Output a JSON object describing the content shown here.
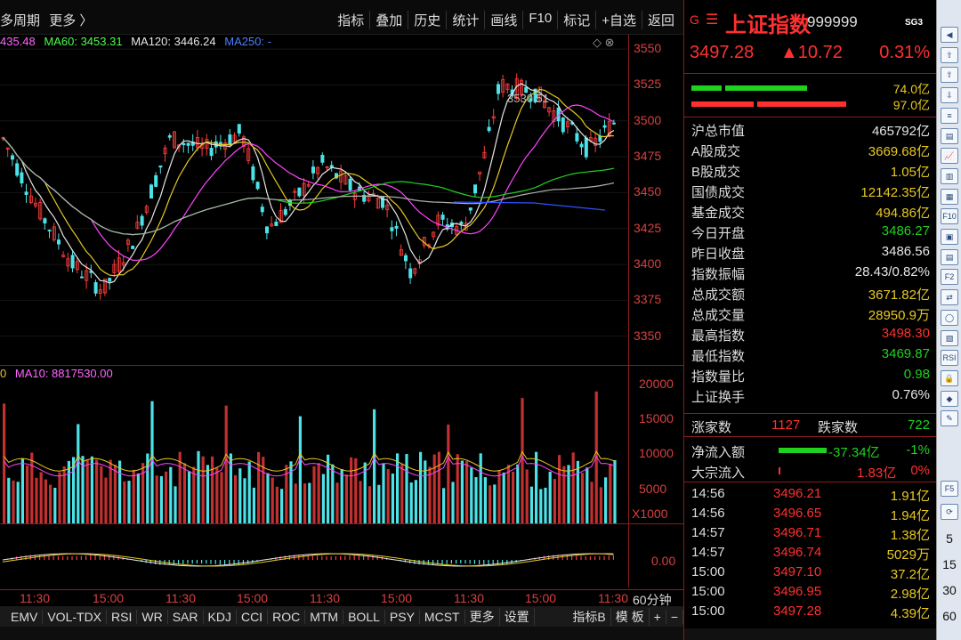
{
  "toolbar": {
    "period_label": "多周期",
    "more_label": "更多 〉",
    "items": [
      "指标",
      "叠加",
      "历史",
      "统计",
      "画线",
      "F10",
      "标记",
      "+自选",
      "返回"
    ]
  },
  "legend": {
    "ma_first": "435.48",
    "ma60": "MA60: 3453.31",
    "ma120": "MA120: 3446.24",
    "ma250": "MA250: -"
  },
  "volume_legend": {
    "prefix": "0",
    "ma10": "MA10: 8817530.00"
  },
  "price_axis": [
    "3550",
    "3525",
    "3500",
    "3475",
    "3450",
    "3425",
    "3400",
    "3375",
    "3350"
  ],
  "volume_axis": [
    "20000",
    "15000",
    "10000",
    "5000"
  ],
  "volume_unit": "X1000",
  "macd_axis": "0.00",
  "peak_label": "3530.51",
  "time_axis": [
    "11:30",
    "15:00",
    "11:30",
    "15:00",
    "11:30",
    "15:00",
    "11:30",
    "15:00",
    "11:30"
  ],
  "period": "60分钟",
  "indicators": [
    "EMV",
    "VOL-TDX",
    "RSI",
    "WR",
    "SAR",
    "KDJ",
    "CCI",
    "ROC",
    "MTM",
    "BOLL",
    "PSY",
    "MCST",
    "更多",
    "设置"
  ],
  "bottom_right": [
    "指标B",
    "模 板",
    "+",
    "−"
  ],
  "stock": {
    "icon_letter": "G",
    "name": "上证指数",
    "code": "999999",
    "tag": "SG3",
    "price": "3497.28",
    "change": "▲10.72",
    "pct": "0.31%",
    "buy_amount": "74.0亿",
    "sell_amount": "97.0亿"
  },
  "stats": [
    {
      "k": "沪总市值",
      "v": "465792亿",
      "c": "white"
    },
    {
      "k": "A股成交",
      "v": "3669.68亿",
      "c": "yellow"
    },
    {
      "k": "B股成交",
      "v": "1.05亿",
      "c": "yellow"
    },
    {
      "k": "国债成交",
      "v": "12142.35亿",
      "c": "yellow"
    },
    {
      "k": "基金成交",
      "v": "494.86亿",
      "c": "yellow"
    },
    {
      "k": "今日开盘",
      "v": "3486.27",
      "c": "green"
    },
    {
      "k": "昨日收盘",
      "v": "3486.56",
      "c": "white"
    },
    {
      "k": "指数振幅",
      "v": "28.43/0.82%",
      "c": "white"
    },
    {
      "k": "总成交额",
      "v": "3671.82亿",
      "c": "yellow"
    },
    {
      "k": "总成交量",
      "v": "28950.9万",
      "c": "yellow"
    },
    {
      "k": "最高指数",
      "v": "3498.30",
      "c": "red"
    },
    {
      "k": "最低指数",
      "v": "3469.87",
      "c": "green"
    },
    {
      "k": "指数量比",
      "v": "0.98",
      "c": "green"
    },
    {
      "k": "上证换手",
      "v": "0.76%",
      "c": "white"
    }
  ],
  "breadth": {
    "up_label": "涨家数",
    "up": "1127",
    "down_label": "跌家数",
    "down": "722"
  },
  "flows": [
    {
      "k": "净流入额",
      "v": "-37.34亿",
      "p": "-1%",
      "c": "green"
    },
    {
      "k": "大宗流入",
      "v": "1.83亿",
      "p": "0%",
      "c": "red"
    }
  ],
  "ticks": [
    {
      "t": "14:56",
      "p": "3496.21",
      "a": "1.91亿"
    },
    {
      "t": "14:56",
      "p": "3496.65",
      "a": "1.94亿"
    },
    {
      "t": "14:57",
      "p": "3496.71",
      "a": "1.38亿"
    },
    {
      "t": "14:57",
      "p": "3496.74",
      "a": "5029万"
    },
    {
      "t": "15:00",
      "p": "3497.10",
      "a": "37.2亿"
    },
    {
      "t": "15:00",
      "p": "3496.95",
      "a": "2.98亿"
    },
    {
      "t": "15:00",
      "p": "3497.28",
      "a": "4.39亿"
    }
  ],
  "sidebar_numbers": [
    "5",
    "15",
    "30",
    "60"
  ]
}
